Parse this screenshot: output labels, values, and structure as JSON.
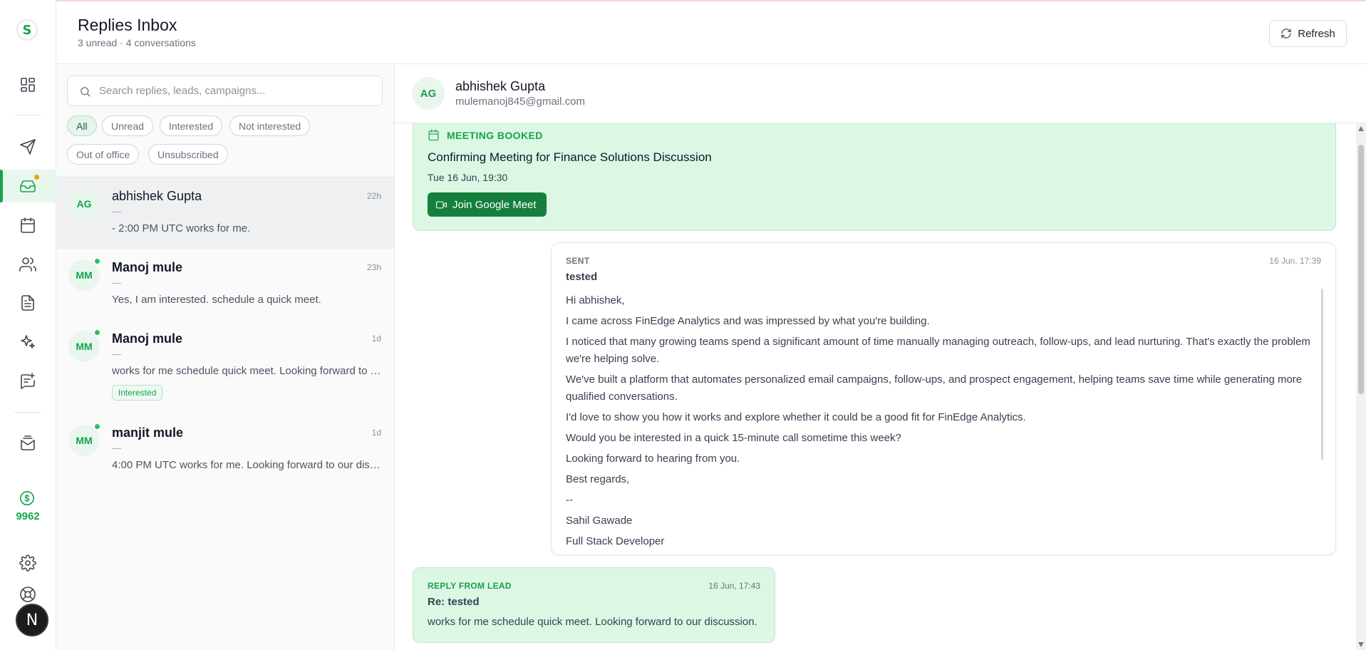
{
  "app": {
    "logo_letter": "S"
  },
  "header": {
    "title": "Replies Inbox",
    "subtitle": "3 unread · 4 conversations",
    "refresh_label": "Refresh"
  },
  "rail": {
    "items": [
      "dashboard-icon",
      "send-icon",
      "inbox-icon",
      "calendar-icon",
      "users-icon",
      "document-icon",
      "sparkles-icon",
      "chat-edit-icon",
      "mail-stack-icon"
    ],
    "active": "inbox-icon",
    "credits": "9962",
    "user_initial": "N"
  },
  "search": {
    "placeholder": "Search replies, leads, campaigns..."
  },
  "filters": [
    "All",
    "Unread",
    "Interested",
    "Not interested",
    "Out of office",
    "Unsubscribed"
  ],
  "active_filter": "All",
  "conversations": [
    {
      "initials": "AG",
      "name": "abhishek Gupta",
      "time": "22h",
      "dash": "—",
      "preview": "- 2:00 PM UTC works for me.",
      "online": false,
      "unread": false,
      "tag": ""
    },
    {
      "initials": "MM",
      "name": "Manoj mule",
      "time": "23h",
      "dash": "—",
      "preview": "Yes, I am interested. schedule a quick meet.",
      "online": true,
      "unread": true,
      "tag": ""
    },
    {
      "initials": "MM",
      "name": "Manoj mule",
      "time": "1d",
      "dash": "—",
      "preview": "works for me schedule quick meet. Looking forward to …",
      "online": true,
      "unread": true,
      "tag": "Interested"
    },
    {
      "initials": "MM",
      "name": "manjit mule",
      "time": "1d",
      "dash": "—",
      "preview": "4:00 PM UTC works for me. Looking forward to our dis…",
      "online": true,
      "unread": true,
      "tag": ""
    }
  ],
  "thread": {
    "initials": "AG",
    "name": "abhishek Gupta",
    "email": "mulemanoj845@gmail.com",
    "meeting": {
      "label": "MEETING BOOKED",
      "subject": "Confirming Meeting for Finance Solutions Discussion",
      "when": "Tue 16 Jun, 19:30",
      "join_label": "Join Google Meet"
    },
    "sent": {
      "kind": "SENT",
      "timestamp": "16 Jun, 17:39",
      "subject": "tested",
      "body": [
        "Hi abhishek,",
        "I came across FinEdge Analytics and was impressed by what you're building.",
        "I noticed that many growing teams spend a significant amount of time manually managing outreach, follow-ups, and lead nurturing. That's exactly the problem we're helping solve.",
        "We've built a platform that automates personalized email campaigns, follow-ups, and prospect engagement, helping teams save time while generating more qualified conversations.",
        "I'd love to show you how it works and explore whether it could be a good fit for FinEdge Analytics.",
        "Would you be interested in a quick 15-minute call sometime this week?",
        "Looking forward to hearing from you.",
        "Best regards,",
        "--",
        "Sahil Gawade",
        "Full Stack Developer"
      ]
    },
    "reply": {
      "kind": "REPLY FROM LEAD",
      "timestamp": "16 Jun, 17:43",
      "subject": "Re: tested",
      "text": "works for me schedule quick meet. Looking forward to our discussion."
    }
  },
  "colors": {
    "accent": "#16a34a",
    "accent_dark": "#15803d",
    "reply_bg": "#dcf7e4",
    "online": "#22c55e",
    "notification": "#f59e0b"
  }
}
